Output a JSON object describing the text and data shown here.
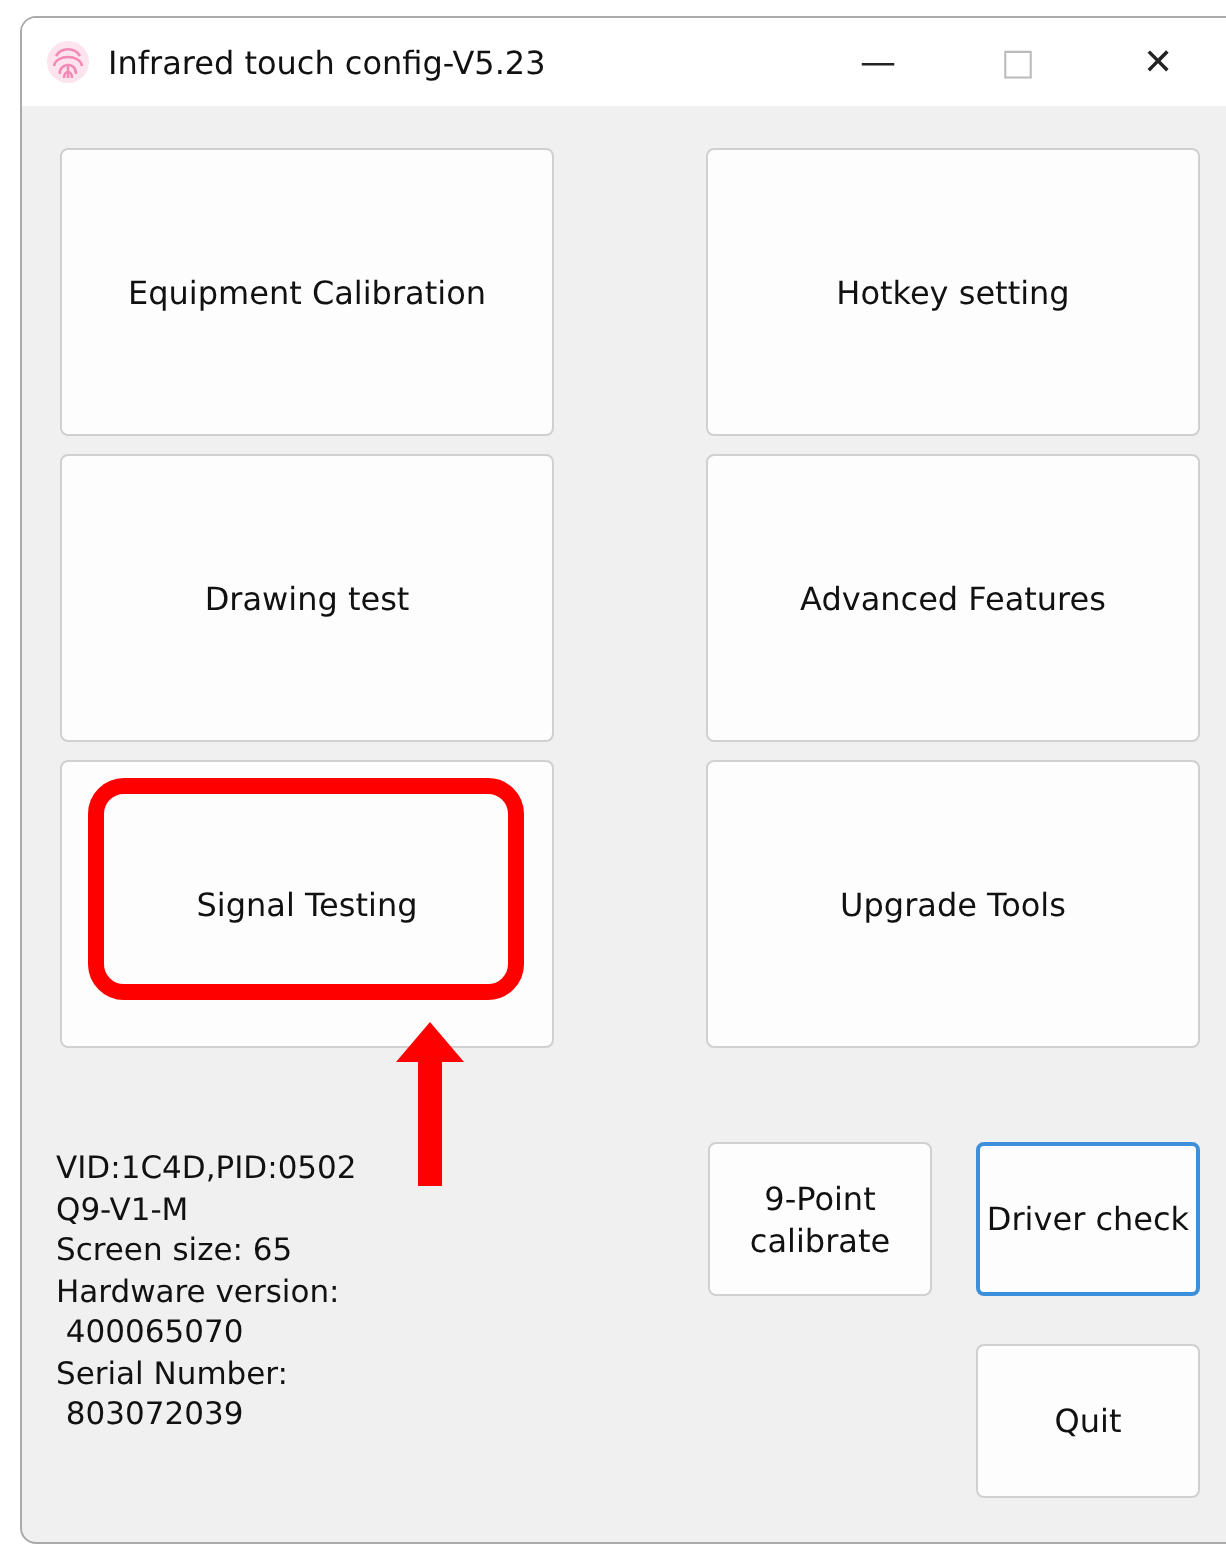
{
  "window": {
    "title": "Infrared touch config-V5.23",
    "controls": [
      "—",
      "□",
      "✕"
    ]
  },
  "main_buttons": [
    {
      "label": "Equipment Calibration"
    },
    {
      "label": "Hotkey setting"
    },
    {
      "label": "Drawing test"
    },
    {
      "label": "Advanced Features"
    },
    {
      "label": "Signal Testing",
      "highlighted": true
    },
    {
      "label": "Upgrade Tools"
    }
  ],
  "device_info": [
    "VID:1C4D,PID:0502",
    "Q9-V1-M",
    "Screen size: 65",
    "Hardware version:",
    " 400065070",
    "Serial Number:",
    " 803072039"
  ],
  "bottom_buttons": [
    {
      "label": "9-Point\ncalibrate",
      "focused": false
    },
    {
      "label": "Driver check",
      "focused": true
    },
    {
      "label": "Quit",
      "focused": false
    }
  ]
}
